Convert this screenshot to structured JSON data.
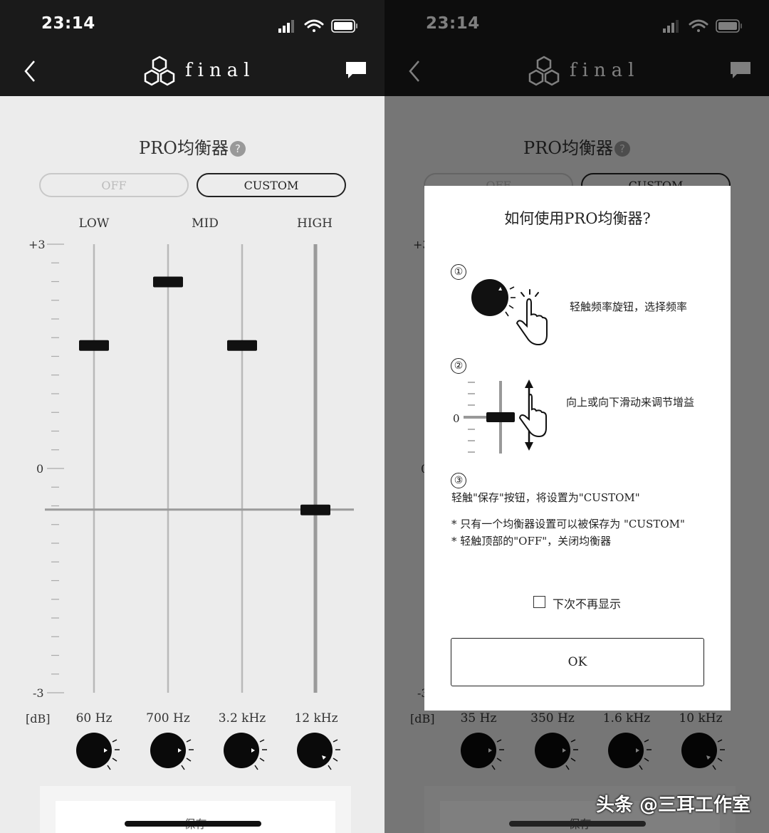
{
  "status_bar": {
    "time": "23:14"
  },
  "nav": {
    "logo_text": "final"
  },
  "screen_title": "PRO均衡器",
  "help_glyph": "?",
  "segments": {
    "off_label": "OFF",
    "custom_label": "CUSTOM",
    "selected": "CUSTOM"
  },
  "band_labels": [
    "LOW",
    "MID",
    "HIGH"
  ],
  "db_labels": {
    "max": "+3",
    "zero": "0",
    "min": "-3",
    "unit": "[dB]"
  },
  "left_screen": {
    "frequencies": [
      "60 Hz",
      "700 Hz",
      "3.2 kHz",
      "12 kHz"
    ],
    "gains_db": [
      1.65,
      2.5,
      1.65,
      -0.55
    ],
    "save_label": "保存"
  },
  "right_screen": {
    "frequencies": [
      "35 Hz",
      "350 Hz",
      "1.6 kHz",
      "10 kHz"
    ],
    "save_label": "保存",
    "dialog": {
      "title": "如何使用PRO均衡器?",
      "step1_num": "①",
      "step1_text": "轻触频率旋钮，选择频率",
      "step2_num": "②",
      "step2_text": "向上或向下滑动来调节增益",
      "step2_zero": "0",
      "step3_num": "③",
      "step3_text": "轻触\"保存\"按钮，将设置为\"CUSTOM\"",
      "note1": "* 只有一个均衡器设置可以被保存为 \"CUSTOM\"",
      "note2": "* 轻触顶部的\"OFF\"，关闭均衡器",
      "checkbox_label": "下次不再显示",
      "ok_label": "OK"
    }
  },
  "watermark": "头条 @三耳工作室",
  "colors": {
    "bar": "#1a1a1a",
    "background": "#ececec",
    "accent": "#111111"
  }
}
